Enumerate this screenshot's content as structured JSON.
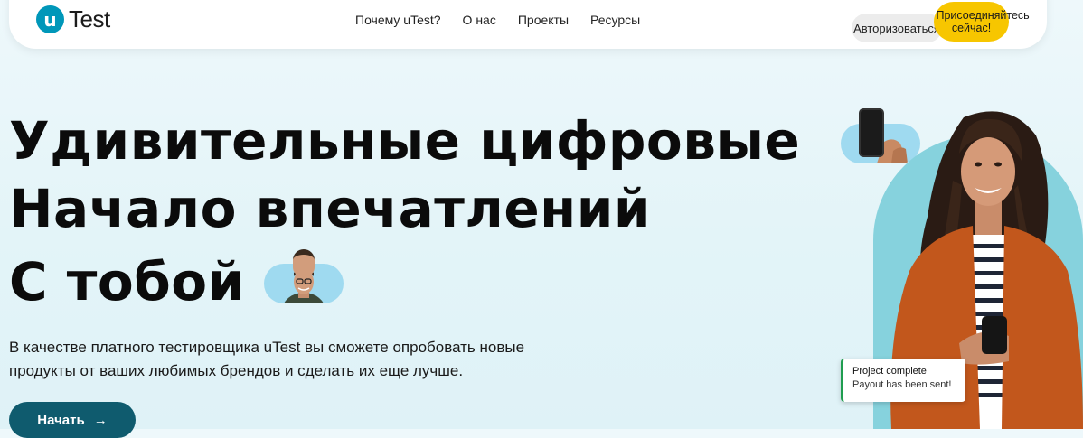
{
  "header": {
    "logo_letter": "u",
    "logo_text": "Test",
    "nav": [
      "Почему uTest?",
      "О нас",
      "Проекты",
      "Ресурсы"
    ],
    "login_label": "Авторизоваться",
    "join_label": "Присоединяйтесь сейчас!"
  },
  "hero": {
    "line1": "Удивительные цифровые",
    "line2": "Начало впечатлений",
    "line3": "С тобой",
    "description_line1": "В качестве платного тестировщика uTest вы сможете опробовать новые",
    "description_line2": "продукты от ваших любимых брендов и сделать их еще лучше.",
    "cta_label": "Начать",
    "cta_arrow": "→"
  },
  "toast": {
    "title": "Project complete",
    "subtitle": "Payout has been sent!"
  },
  "colors": {
    "brand": "#0097b9",
    "join_button": "#f7c600",
    "cta_button": "#0f5b6e",
    "pill": "#9fdaf0",
    "arch": "#86d2dd",
    "toast_accent": "#1f9d4f"
  }
}
